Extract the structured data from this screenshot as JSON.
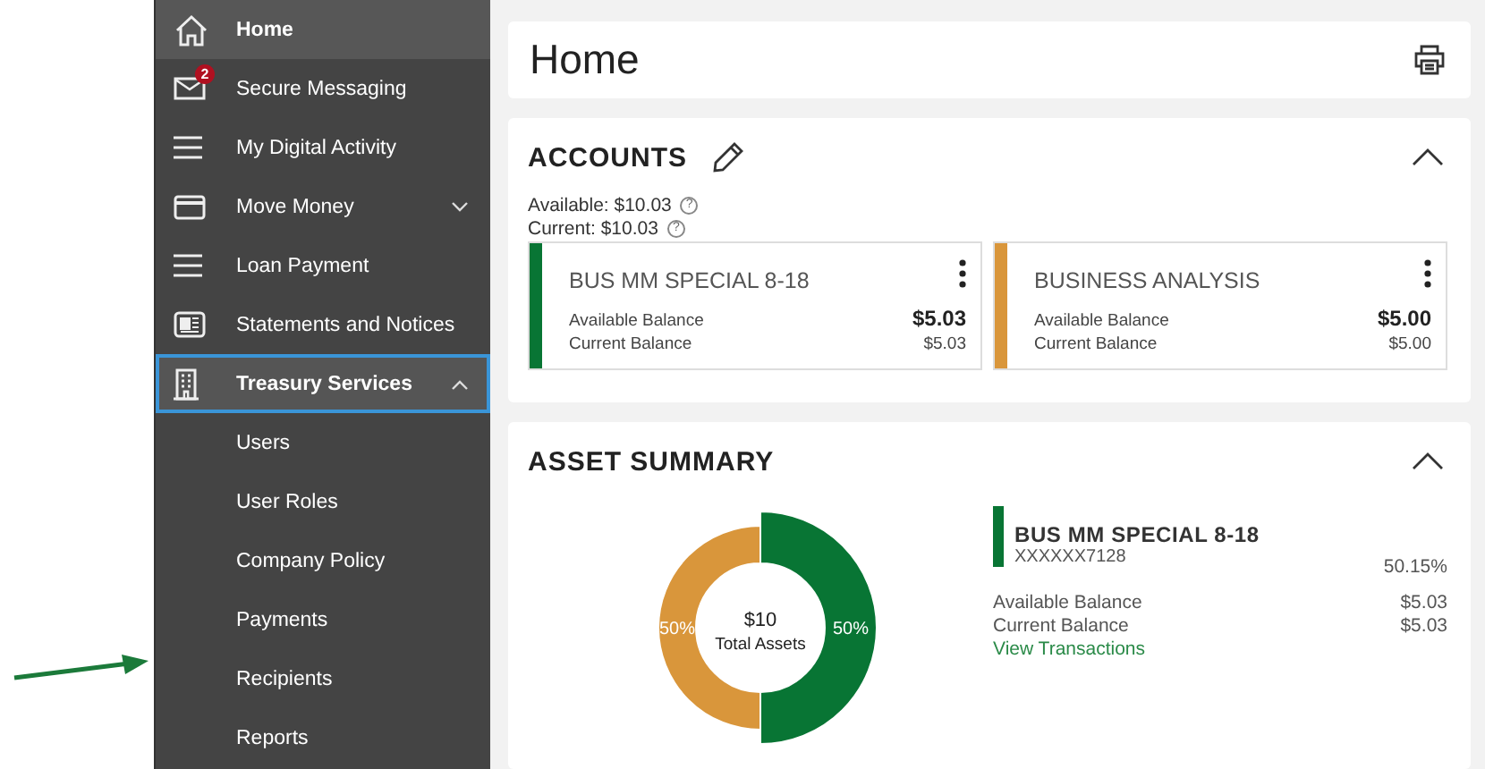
{
  "sidebar": {
    "items": [
      {
        "label": "Home",
        "selected": true,
        "focused": false
      },
      {
        "label": "Secure Messaging",
        "selected": false,
        "focused": false,
        "badge": "2"
      },
      {
        "label": "My Digital Activity",
        "selected": false,
        "focused": false
      },
      {
        "label": "Move Money",
        "selected": false,
        "focused": false,
        "expanded": false
      },
      {
        "label": "Loan Payment",
        "selected": false,
        "focused": false
      },
      {
        "label": "Statements and Notices",
        "selected": false,
        "focused": false
      },
      {
        "label": "Treasury Services",
        "selected": false,
        "focused": true,
        "expanded": true,
        "children": [
          {
            "label": "Users"
          },
          {
            "label": "User Roles"
          },
          {
            "label": "Company Policy"
          },
          {
            "label": "Payments"
          },
          {
            "label": "Recipients"
          },
          {
            "label": "Reports"
          }
        ]
      }
    ]
  },
  "page_title": "Home",
  "accounts": {
    "title": "ACCOUNTS",
    "expanded": true,
    "totals": [
      {
        "text": "Available: $10.03",
        "help": "?"
      },
      {
        "text": "Current: $10.03",
        "help": "?"
      }
    ],
    "cards": [
      {
        "name": "BUS MM SPECIAL 8-18",
        "color": "#087534",
        "available_label": "Available Balance",
        "available": "$5.03",
        "current_label": "Current Balance",
        "current": "$5.03"
      },
      {
        "name": "BUSINESS ANALYSIS",
        "color": "#d9963b",
        "available_label": "Available Balance",
        "available": "$5.00",
        "current_label": "Current Balance",
        "current": "$5.00"
      }
    ]
  },
  "asset_summary": {
    "title": "ASSET SUMMARY",
    "expanded": true,
    "chart_data": {
      "type": "donut",
      "values": [
        50,
        50
      ],
      "value_labels": [
        "50%",
        "50%"
      ]
    },
    "center_value": "$10",
    "center_label": "Total Assets",
    "detail": {
      "name": "BUS MM SPECIAL 8-18",
      "color": "#087534",
      "number": "XXXXXX7128",
      "share": "50.15%",
      "available_label": "Available Balance",
      "available": "$5.03",
      "current_label": "Current Balance",
      "current": "$5.03",
      "link": "View Transactions"
    }
  }
}
